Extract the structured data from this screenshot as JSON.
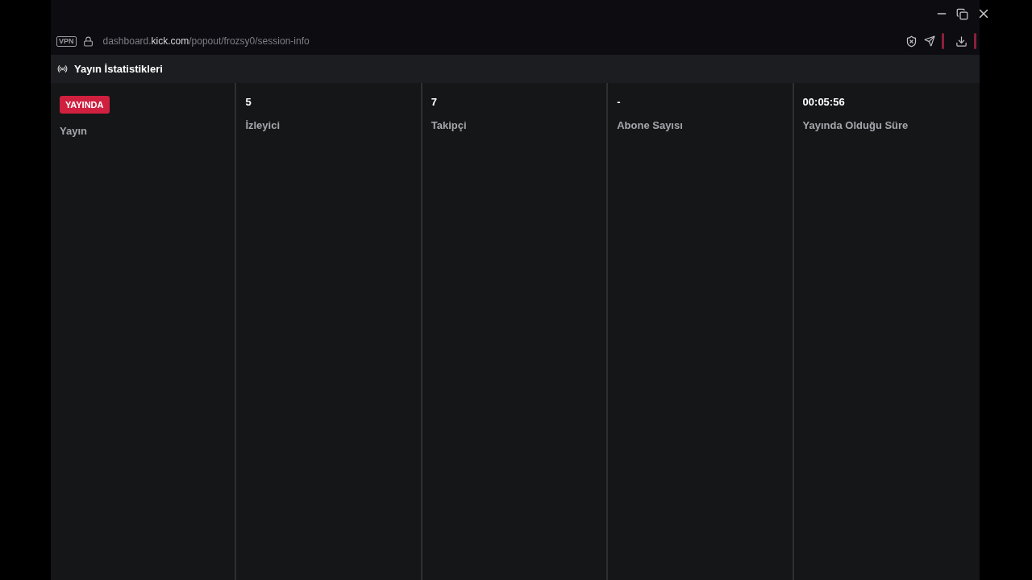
{
  "browser": {
    "vpn_label": "VPN",
    "url_prefix": "dashboard.",
    "url_domain": "kick.com",
    "url_path": "/popout/frozsy0/session-info"
  },
  "panel": {
    "title": "Yayın İstatistikleri"
  },
  "stats": [
    {
      "kind": "badge",
      "value": "YAYINDA",
      "label": "Yayın"
    },
    {
      "kind": "value",
      "value": "5",
      "label": "İzleyici"
    },
    {
      "kind": "value",
      "value": "7",
      "label": "Takipçi"
    },
    {
      "kind": "value",
      "value": "-",
      "label": "Abone Sayısı"
    },
    {
      "kind": "value",
      "value": "00:05:56",
      "label": "Yayında Olduğu Süre"
    }
  ]
}
